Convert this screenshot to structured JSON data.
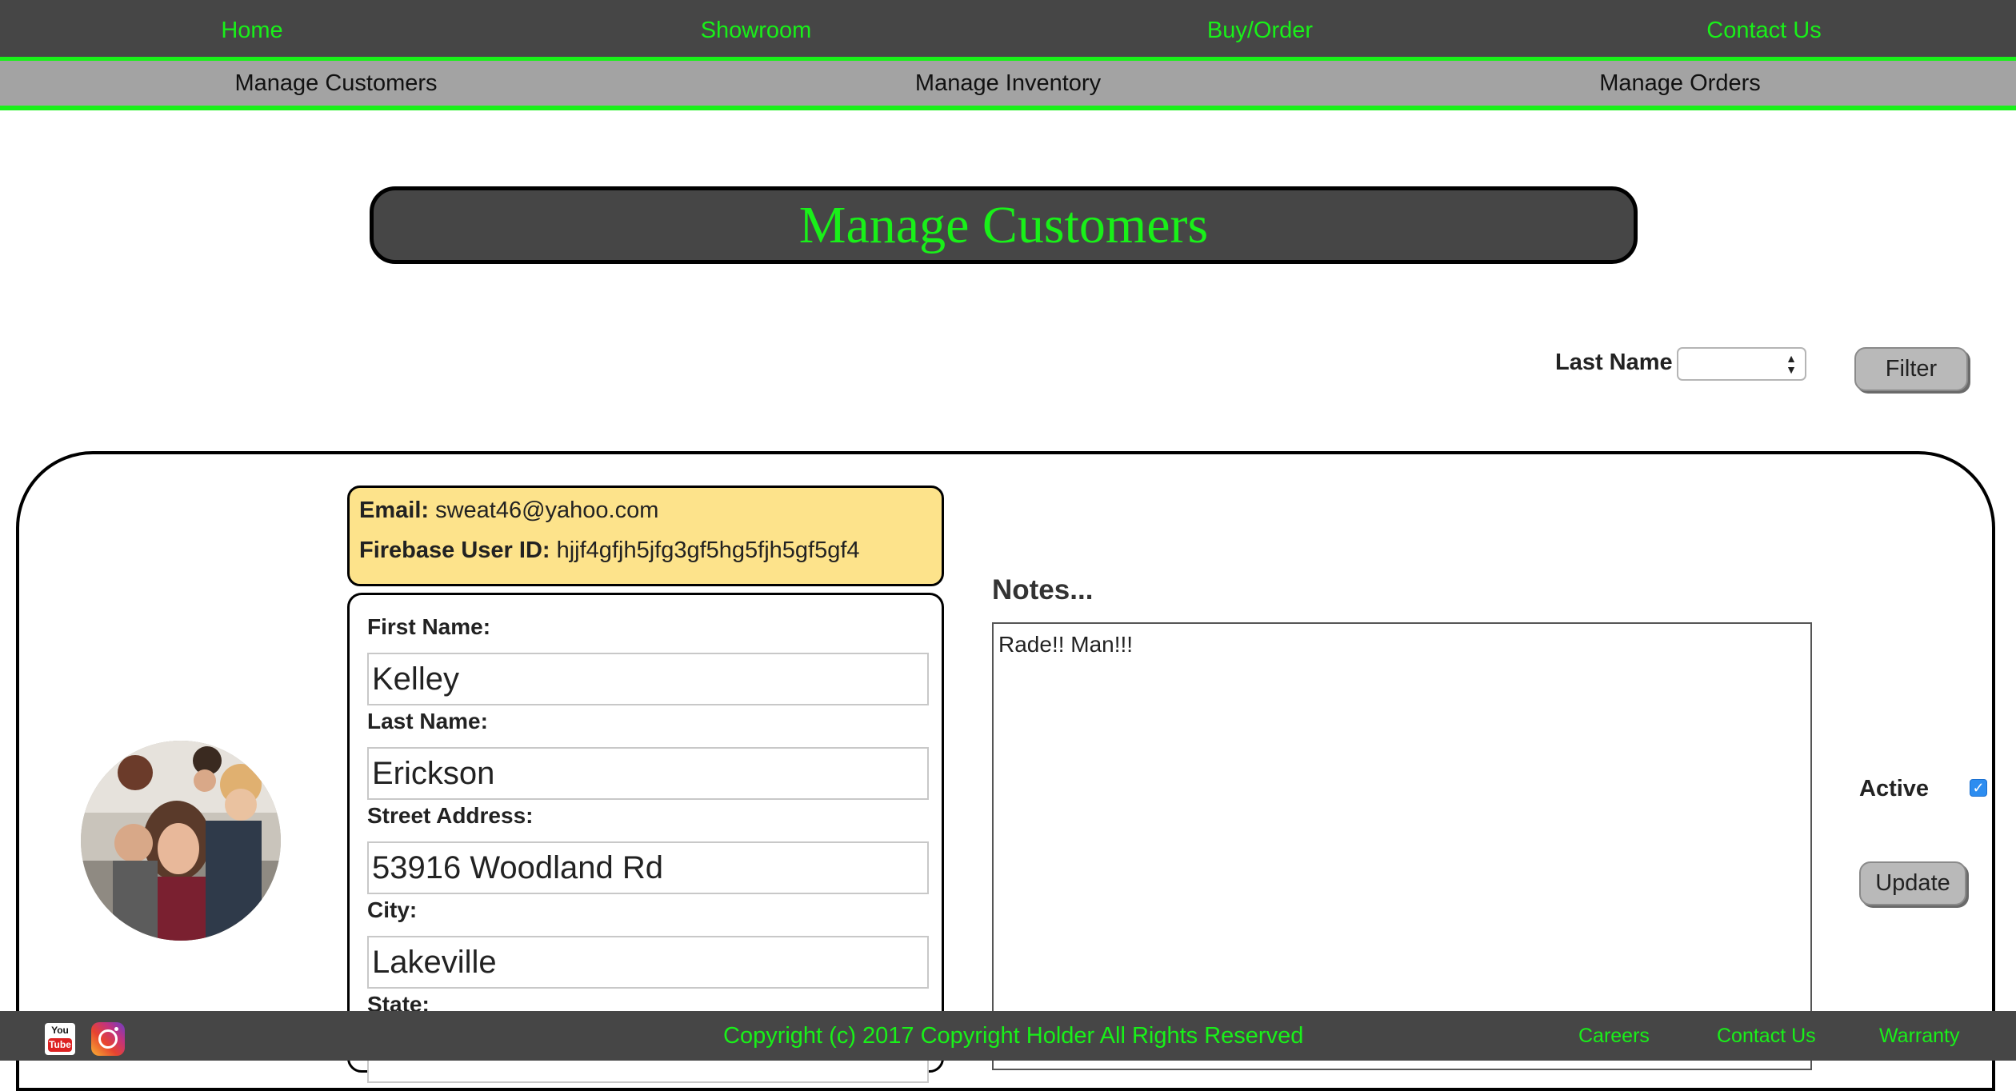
{
  "nav": {
    "items": [
      {
        "label": "Home"
      },
      {
        "label": "Showroom"
      },
      {
        "label": "Buy/Order"
      },
      {
        "label": "Contact Us"
      }
    ]
  },
  "subnav": {
    "items": [
      {
        "label": "Manage Customers"
      },
      {
        "label": "Manage Inventory"
      },
      {
        "label": "Manage Orders"
      }
    ]
  },
  "page": {
    "title": "Manage Customers"
  },
  "filter": {
    "label": "Last Name",
    "selected": "",
    "button": "Filter"
  },
  "customer": {
    "email_label": "Email:",
    "email": "sweat46@yahoo.com",
    "uid_label": "Firebase User ID:",
    "uid": "hjjf4gfjh5jfg3gf5hg5fjh5gf5gf4",
    "fields": [
      {
        "label": "First Name:",
        "value": "Kelley"
      },
      {
        "label": "Last Name:",
        "value": "Erickson"
      },
      {
        "label": "Street Address:",
        "value": "53916 Woodland Rd"
      },
      {
        "label": "City:",
        "value": "Lakeville"
      },
      {
        "label": "State:",
        "value": ""
      }
    ],
    "notes_label": "Notes...",
    "notes": "Rade!! Man!!!",
    "active_label": "Active",
    "active": true,
    "update_button": "Update"
  },
  "footer": {
    "social": [
      "youtube-icon",
      "instagram-icon"
    ],
    "youtube_text_top": "You",
    "youtube_text_bottom": "Tube",
    "copyright": "Copyright (c) 2017 Copyright Holder All Rights Reserved",
    "links": [
      {
        "label": "Careers"
      },
      {
        "label": "Contact Us"
      },
      {
        "label": "Warranty"
      }
    ]
  },
  "colors": {
    "accent": "#19f019",
    "nav_bg": "#464646",
    "subnav_bg": "#a3a3a3",
    "info_bg": "#fde38b"
  }
}
